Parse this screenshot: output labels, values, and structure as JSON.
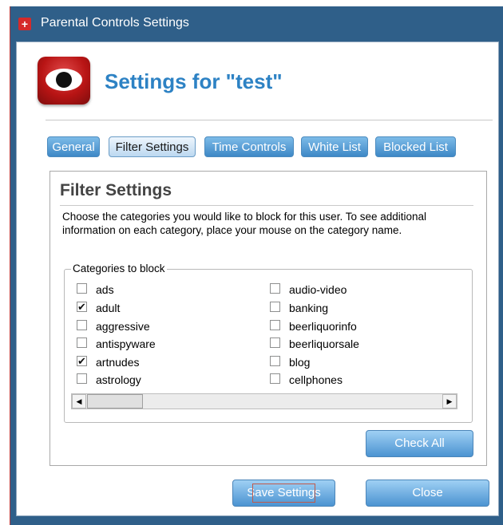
{
  "window": {
    "title": "Parental Controls Settings"
  },
  "header": {
    "title": "Settings for \"test\""
  },
  "tabs": [
    {
      "label": "General"
    },
    {
      "label": "Filter Settings"
    },
    {
      "label": "Time Controls"
    },
    {
      "label": "White List"
    },
    {
      "label": "Blocked List"
    }
  ],
  "panel": {
    "title": "Filter Settings",
    "description": "Choose the categories you would like to block for this user. To see additional information on each category, place your mouse on the category name.",
    "group_label": "Categories to block",
    "categories": [
      {
        "label": "ads",
        "checked": false
      },
      {
        "label": "adult",
        "checked": true
      },
      {
        "label": "aggressive",
        "checked": false
      },
      {
        "label": "antispyware",
        "checked": false
      },
      {
        "label": "artnudes",
        "checked": true
      },
      {
        "label": "astrology",
        "checked": false
      },
      {
        "label": "audio-video",
        "checked": false
      },
      {
        "label": "banking",
        "checked": false
      },
      {
        "label": "beerliquorinfo",
        "checked": false
      },
      {
        "label": "beerliquorsale",
        "checked": false
      },
      {
        "label": "blog",
        "checked": false
      },
      {
        "label": "cellphones",
        "checked": false
      }
    ],
    "check_all_label": "Check All"
  },
  "footer": {
    "save_label": "Save Settings",
    "close_label": "Close"
  },
  "icons": {
    "app": "shield-icon",
    "logo": "eye-icon",
    "check": "✔",
    "scroll_left": "◀",
    "scroll_right": "▶"
  }
}
